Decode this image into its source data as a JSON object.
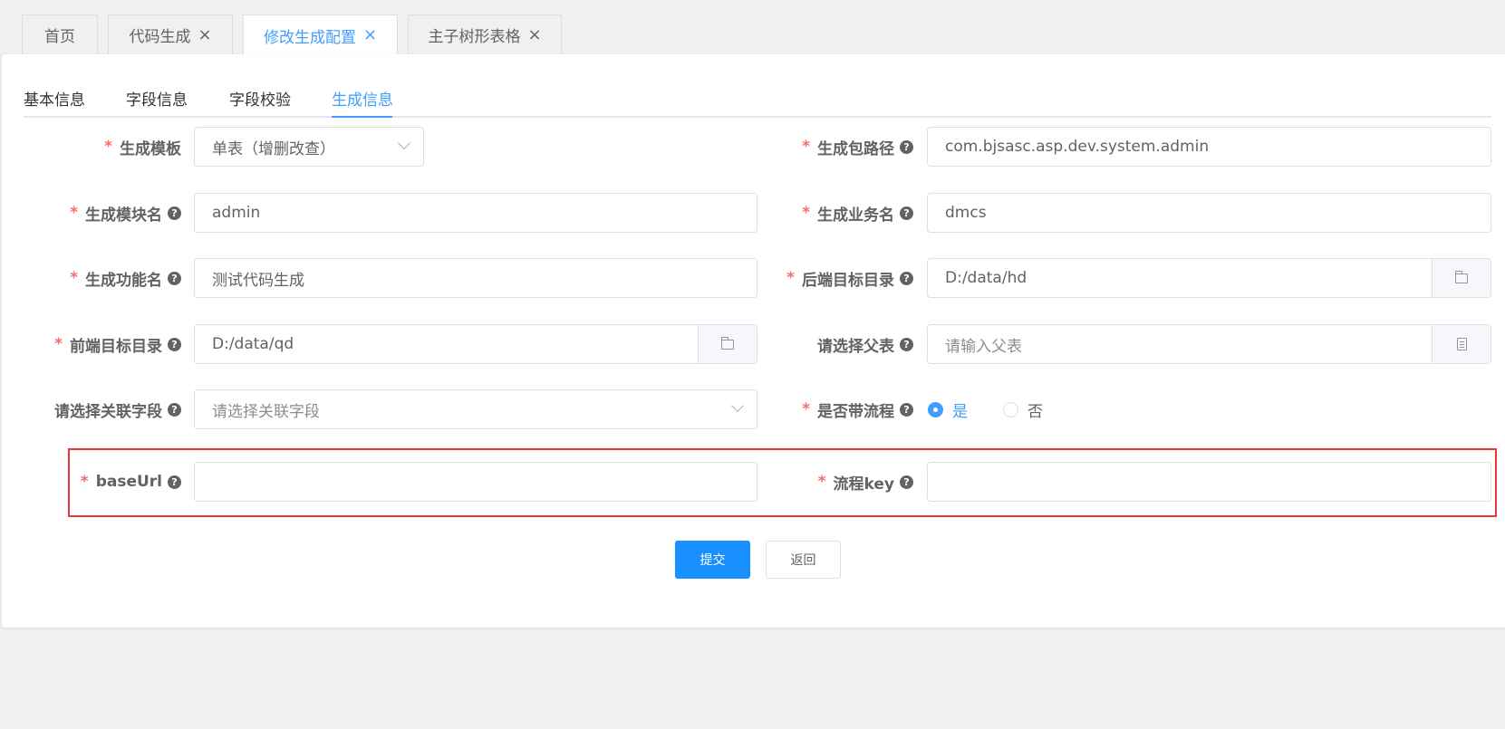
{
  "page_tabs": [
    {
      "label": "首页",
      "closable": false,
      "active": false
    },
    {
      "label": "代码生成",
      "closable": true,
      "active": false
    },
    {
      "label": "修改生成配置",
      "closable": true,
      "active": true
    },
    {
      "label": "主子树形表格",
      "closable": true,
      "active": false
    }
  ],
  "close_glyph": "×",
  "sub_tabs": [
    "基本信息",
    "字段信息",
    "字段校验",
    "生成信息"
  ],
  "form": {
    "template": {
      "label": "生成模板",
      "value": "单表（增删改查）"
    },
    "package": {
      "label": "生成包路径",
      "value": "com.bjsasc.asp.dev.system.admin"
    },
    "module": {
      "label": "生成模块名",
      "value": "admin"
    },
    "business": {
      "label": "生成业务名",
      "value": "dmcs"
    },
    "function": {
      "label": "生成功能名",
      "value": "测试代码生成"
    },
    "backend_dir": {
      "label": "后端目标目录",
      "value": "D:/data/hd"
    },
    "frontend_dir": {
      "label": "前端目标目录",
      "value": "D:/data/qd"
    },
    "parent_table": {
      "label": "请选择父表",
      "placeholder": "请输入父表"
    },
    "relation_field": {
      "label": "请选择关联字段",
      "placeholder": "请选择关联字段"
    },
    "with_process": {
      "label": "是否带流程",
      "options": [
        "是",
        "否"
      ],
      "selected": "是"
    },
    "base_url": {
      "label": "baseUrl",
      "value": ""
    },
    "process_key": {
      "label": "流程key",
      "value": ""
    }
  },
  "required_mark": "*",
  "help_glyph": "?",
  "buttons": {
    "submit": "提交",
    "back": "返回"
  },
  "colors": {
    "accent": "#409eff",
    "primary_button": "#1890ff",
    "required": "#f56c6c",
    "highlight_box": "#e53935"
  }
}
